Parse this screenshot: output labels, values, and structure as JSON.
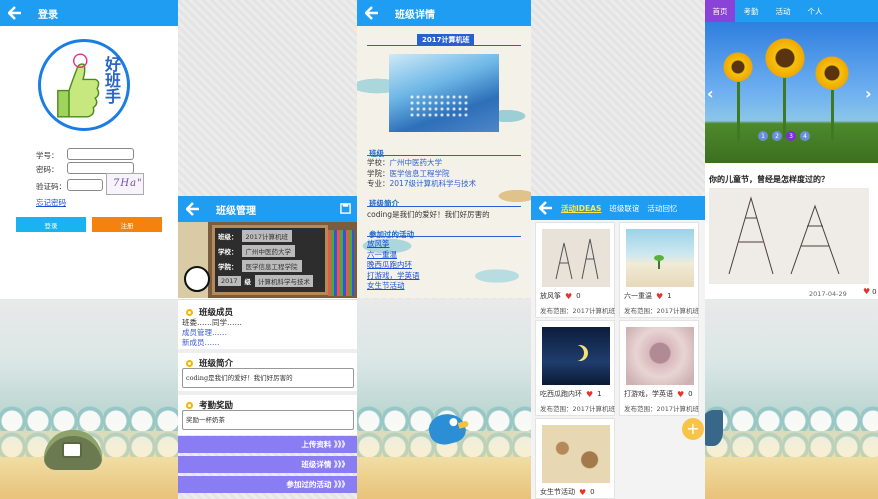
{
  "login": {
    "title": "登录",
    "logo_text": "好班手",
    "student_id_label": "学号：",
    "password_label": "密码：",
    "captcha_label": "验证码：",
    "captcha_text": "7Ha\"",
    "forgot": "忘记密码",
    "login_btn": "登录",
    "register_btn": "注册"
  },
  "manage": {
    "title": "班级管理",
    "banner": {
      "class_label": "班级：",
      "class_value": "2017计算机班",
      "school_label": "学校：",
      "school_value": "广州中医药大学",
      "college_label": "学院：",
      "college_value": "医学信息工程学院",
      "year": "2017",
      "grade_label": "级",
      "major_value": "计算机科学与技术"
    },
    "members": {
      "title": "班级成员",
      "line": "班委……同学……",
      "link1": "成员管理……",
      "link2": "新成员……"
    },
    "intro": {
      "title": "班级简介",
      "value": "coding是我们的爱好！我们好厉害的"
    },
    "reward": {
      "title": "考勤奖励",
      "value": "奖励一杯奶茶"
    },
    "buttons": [
      "上传资料 》》》",
      "班级详情 》》》",
      "参加过的活动 》》》"
    ]
  },
  "detail": {
    "title": "班级详情",
    "class_name": "2017计算机班",
    "section1": "班级",
    "school": "学校：",
    "school_link": "广州中医药大学",
    "college": "学院：",
    "college_link": "医学信息工程学院",
    "major": "专业：",
    "major_link": "2017级计算机科学与技术",
    "section2": "班级简介",
    "intro": "coding是我们的爱好！我们好厉害的",
    "section3": "参加过的活动",
    "activities": [
      "放风筝",
      "六一重温",
      "晚西瓜跑内环",
      "打游戏，学英语",
      "女生节活动"
    ]
  },
  "ideas": {
    "tab_active": "活动IDEAS",
    "tab2": "班级联谊",
    "tab3": "活动回忆",
    "cards": [
      {
        "title": "放风筝",
        "likes": "0",
        "footer": "发布范围：2017计算机班"
      },
      {
        "title": "六一重温",
        "likes": "1",
        "footer": "发布范围：2017计算机班"
      },
      {
        "title": "吃西瓜跑内环",
        "likes": "1",
        "footer": "发布范围：2017计算机班"
      },
      {
        "title": "打游戏，学英语",
        "likes": "0",
        "footer": "发布范围：2017计算机班"
      },
      {
        "title": "女生节活动",
        "likes": "0",
        "footer": ""
      }
    ]
  },
  "home": {
    "tabs": [
      "首页",
      "考勤",
      "活动",
      "个人"
    ],
    "dots": [
      "1",
      "2",
      "3",
      "4"
    ],
    "active_dot": 3,
    "article_title": "你的儿童节，曾经是怎样度过的？",
    "timestamp": "2017-04-29 17:22:32",
    "likes": "0"
  },
  "colors": {
    "primary": "#1f9df2",
    "login_btn": "#19b3f0",
    "register_btn": "#f5820d",
    "purple": "#8a7df4",
    "heart": "#e5332a"
  }
}
